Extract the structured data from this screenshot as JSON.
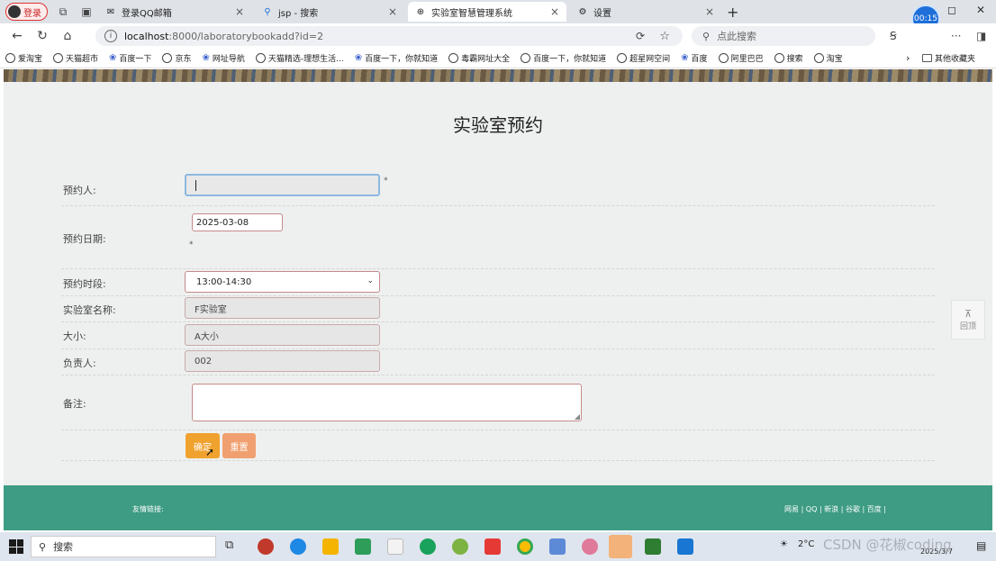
{
  "browser": {
    "profile_label": "登录",
    "timer": "00:15",
    "tabs": [
      {
        "label": "登录QQ邮箱",
        "icon": "mail-icon",
        "active": false
      },
      {
        "label": "jsp - 搜索",
        "icon": "search-icon",
        "active": false
      },
      {
        "label": "实验室智慧管理系统",
        "icon": "globe-icon",
        "active": true
      },
      {
        "label": "设置",
        "icon": "gear-icon",
        "active": false
      }
    ],
    "address": {
      "host": "localhost",
      "path": ":8000/laboratorybookadd?id=2"
    },
    "search_placeholder": "点此搜索",
    "bookmarks": [
      {
        "label": "爱淘宝",
        "icon": "globe"
      },
      {
        "label": "天猫超市",
        "icon": "globe"
      },
      {
        "label": "百度一下",
        "icon": "paw"
      },
      {
        "label": "京东",
        "icon": "globe"
      },
      {
        "label": "网址导航",
        "icon": "paw"
      },
      {
        "label": "天猫精选-理想生活...",
        "icon": "globe"
      },
      {
        "label": "百度一下，你就知道",
        "icon": "paw"
      },
      {
        "label": "毒霸网址大全",
        "icon": "globe"
      },
      {
        "label": "百度一下，你就知道",
        "icon": "globe"
      },
      {
        "label": "超星网空间",
        "icon": "globe"
      },
      {
        "label": "百度",
        "icon": "paw"
      },
      {
        "label": "阿里巴巴",
        "icon": "globe"
      },
      {
        "label": "搜索",
        "icon": "globe"
      },
      {
        "label": "淘宝",
        "icon": "globe"
      }
    ],
    "bookmarks_other": "其他收藏夹"
  },
  "page": {
    "title": "实验室预约",
    "form": {
      "booker": {
        "label": "预约人:",
        "value": ""
      },
      "date": {
        "label": "预约日期:",
        "value": "2025-03-08"
      },
      "time_slot": {
        "label": "预约时段:",
        "value": "13:00-14:30"
      },
      "lab_name": {
        "label": "实验室名称:",
        "value": "F实验室"
      },
      "size": {
        "label": "大小:",
        "value": "A大小"
      },
      "manager": {
        "label": "负责人:",
        "value": "002"
      },
      "remark": {
        "label": "备注:",
        "value": ""
      },
      "required_mark": "*"
    },
    "buttons": {
      "submit": "确定",
      "reset": "重置"
    },
    "back_to_top": "回顶",
    "footer": {
      "links_label": "友情链接:",
      "links": "网易 | QQ | 新浪 | 谷歌 | 百度 |"
    }
  },
  "taskbar": {
    "search_placeholder": "搜索",
    "weather": "2°C",
    "watermark": "CSDN @花椒coding",
    "date": "2025/3/7"
  },
  "colors": {
    "footer": "#3e9c84",
    "submit": "#f0a22f",
    "reset": "#f0a070",
    "field_border": "#c58a8a",
    "timer": "#1e6fd9"
  }
}
